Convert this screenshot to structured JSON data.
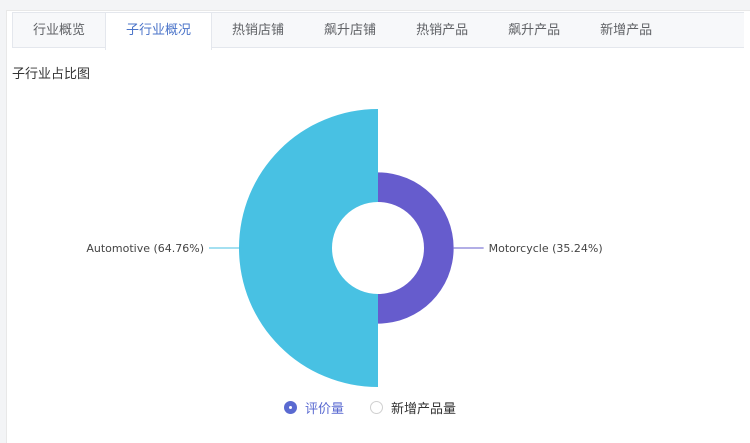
{
  "tabs": [
    {
      "label": "行业概览",
      "active": false
    },
    {
      "label": "子行业概况",
      "active": true
    },
    {
      "label": "热销店铺",
      "active": false
    },
    {
      "label": "飙升店铺",
      "active": false
    },
    {
      "label": "热销产品",
      "active": false
    },
    {
      "label": "飙升产品",
      "active": false
    },
    {
      "label": "新增产品",
      "active": false
    }
  ],
  "section_title": "子行业占比图",
  "legend": [
    {
      "label": "评价量",
      "selected": true
    },
    {
      "label": "新增产品量",
      "selected": false
    }
  ],
  "colors": {
    "accent": "#4b74c9",
    "radio_on": "#5a6ad1"
  },
  "chart_data": {
    "type": "pie",
    "variant": "rose",
    "series": [
      {
        "name": "Automotive",
        "value": 64.76,
        "label": "Automotive (64.76%)",
        "color": "#48c1e3"
      },
      {
        "name": "Motorcycle",
        "value": 35.24,
        "label": "Motorcycle (35.24%)",
        "color": "#665ccd"
      }
    ]
  }
}
